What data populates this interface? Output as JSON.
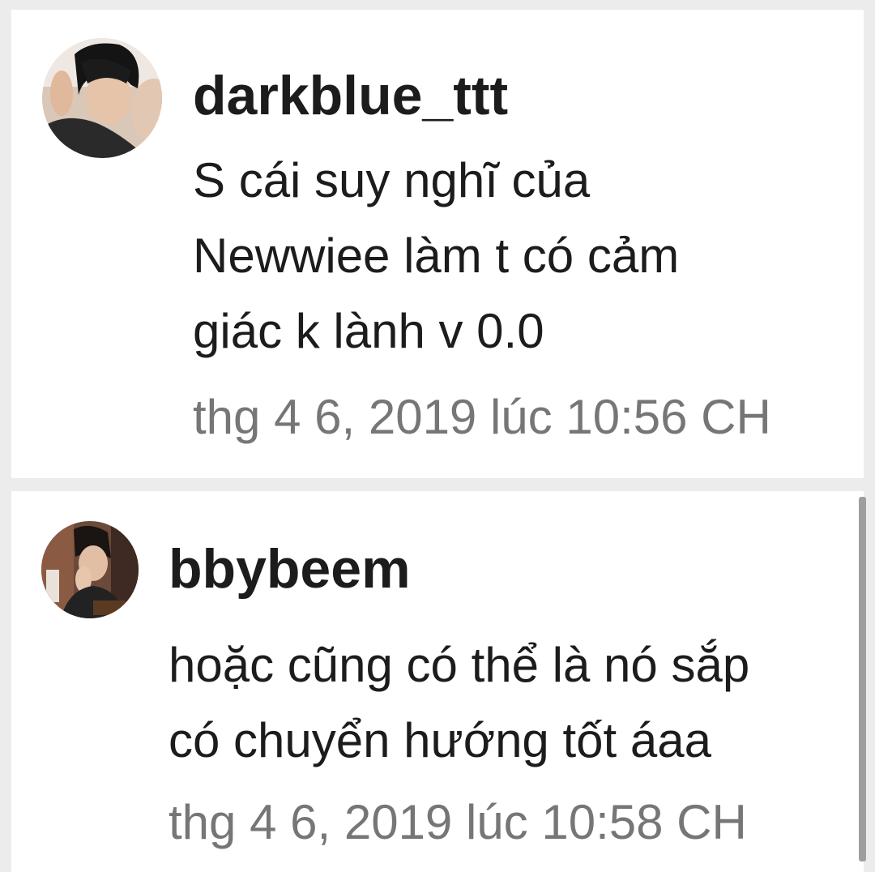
{
  "comments": [
    {
      "username": "darkblue_ttt",
      "text_lines": [
        "S cái suy nghĩ của",
        "Newwiee làm t có cảm",
        "giác k lành v 0.0"
      ],
      "timestamp": "thg 4 6, 2019 lúc 10:56 CH"
    },
    {
      "username": "bbybeem",
      "text_lines": [
        "hoặc cũng có thể là nó sắp",
        "có chuyển hướng tốt áaa"
      ],
      "timestamp": "thg 4 6, 2019 lúc 10:58 CH"
    }
  ],
  "colors": {
    "background": "#ececec",
    "card": "#ffffff",
    "username": "#1c1c1c",
    "text": "#1c1c1c",
    "timestamp": "#767676",
    "scrollbar": "#9e9e9e"
  }
}
